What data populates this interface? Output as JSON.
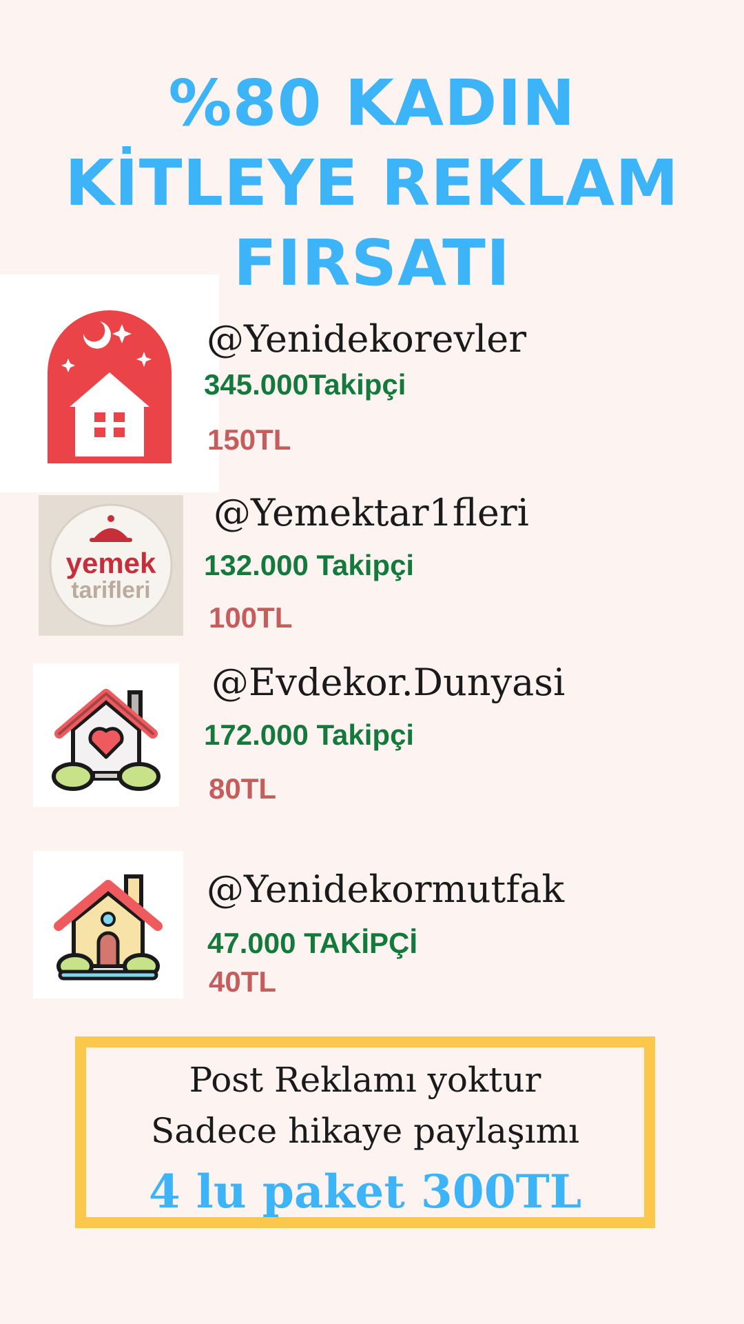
{
  "headline": {
    "line1": "%80 KADIN",
    "line2": "KİTLEYE REKLAM",
    "line3": "FIRSATI"
  },
  "accounts": [
    {
      "handle": "@Yenidekorevler",
      "followers": "345.000Takipçi",
      "price": "150TL",
      "icon": "red-house-night-icon"
    },
    {
      "handle": "@Yemektar1fleri",
      "followers": "132.000 Takipçi",
      "price": "100TL",
      "icon": "yemek-tarifleri-logo",
      "logo_text": [
        "yemek",
        "tarifleri"
      ]
    },
    {
      "handle": "@Evdekor.Dunyasi",
      "followers": "172.000 Takipçi",
      "price": "80TL",
      "icon": "heart-house-icon"
    },
    {
      "handle": "@Yenidekormutfak",
      "followers": "47.000 TAKİPÇİ",
      "price": "40TL",
      "icon": "cottage-house-icon"
    }
  ],
  "notice": {
    "line1": "Post Reklamı yoktur",
    "line2": "Sadece hikaye paylaşımı",
    "package": "4 lu paket 300TL"
  },
  "colors": {
    "background": "#fdf4f2",
    "headline": "#3db4f7",
    "followers": "#137a3c",
    "price": "#c65d5d",
    "box_border": "#fbc84c"
  }
}
